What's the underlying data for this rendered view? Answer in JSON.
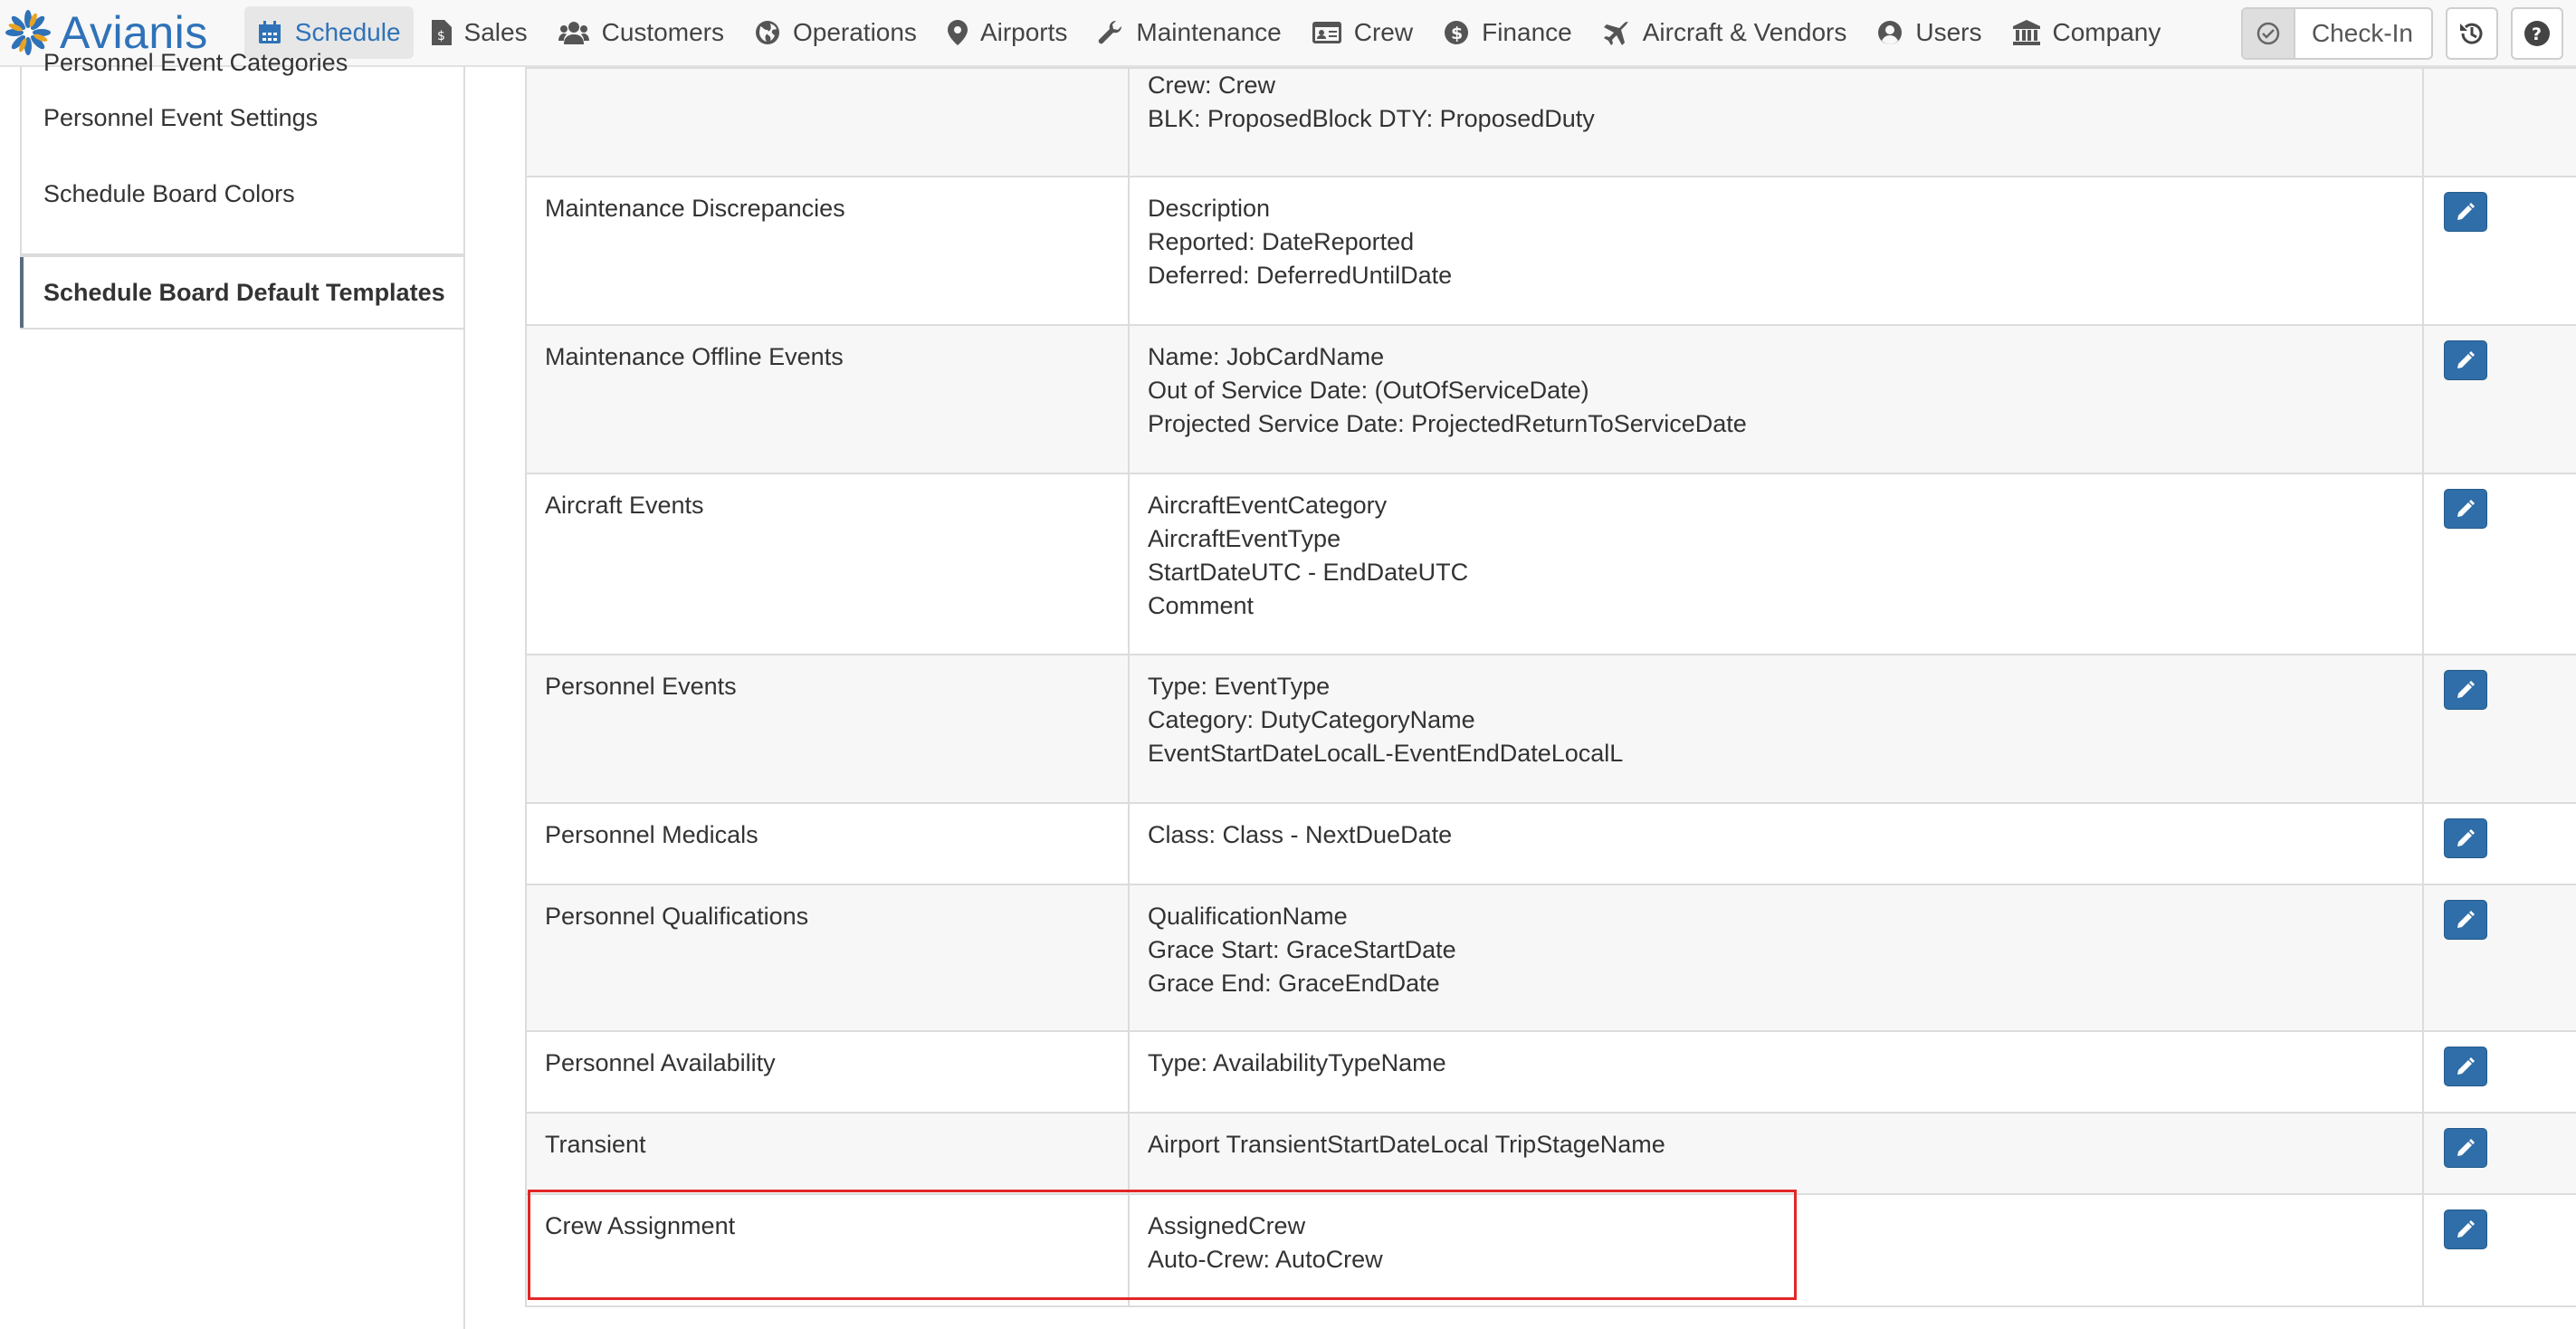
{
  "app": {
    "name": "Avianis"
  },
  "nav": {
    "items": [
      {
        "label": "Schedule",
        "icon": "calendar-icon",
        "active": true
      },
      {
        "label": "Sales",
        "icon": "invoice-icon"
      },
      {
        "label": "Customers",
        "icon": "users-group-icon"
      },
      {
        "label": "Operations",
        "icon": "globe-icon"
      },
      {
        "label": "Airports",
        "icon": "map-marker-icon"
      },
      {
        "label": "Maintenance",
        "icon": "wrench-icon"
      },
      {
        "label": "Crew",
        "icon": "id-card-icon"
      },
      {
        "label": "Finance",
        "icon": "dollar-icon"
      },
      {
        "label": "Aircraft & Vendors",
        "icon": "plane-icon"
      },
      {
        "label": "Users",
        "icon": "user-circle-icon"
      },
      {
        "label": "Company",
        "icon": "building-icon"
      }
    ],
    "checkin_label": "Check-In"
  },
  "sidebar": {
    "items": [
      {
        "label": "Personnel Event Categories"
      },
      {
        "label": "Personnel Event Settings"
      },
      {
        "label": "Schedule Board Colors"
      },
      {
        "label": "Schedule Board Default Templates",
        "active": true
      }
    ]
  },
  "table": {
    "rows": [
      {
        "name": "",
        "template": [
          "",
          "Crew: Crew",
          "BLK: ProposedBlock DTY: ProposedDuty"
        ]
      },
      {
        "name": "Maintenance Discrepancies",
        "template": [
          "Description",
          "Reported: DateReported",
          "Deferred: DeferredUntilDate"
        ]
      },
      {
        "name": "Maintenance Offline Events",
        "template": [
          "Name: JobCardName",
          "Out of Service Date: (OutOfServiceDate)",
          "Projected Service Date: ProjectedReturnToServiceDate"
        ]
      },
      {
        "name": "Aircraft Events",
        "template": [
          "AircraftEventCategory",
          "AircraftEventType",
          "StartDateUTC - EndDateUTC",
          "Comment"
        ]
      },
      {
        "name": "Personnel Events",
        "template": [
          "Type: EventType",
          "Category: DutyCategoryName",
          "EventStartDateLocalL-EventEndDateLocalL"
        ]
      },
      {
        "name": "Personnel Medicals",
        "template": [
          "Class: Class - NextDueDate"
        ]
      },
      {
        "name": "Personnel Qualifications",
        "template": [
          "QualificationName",
          "Grace Start: GraceStartDate",
          "Grace End: GraceEndDate"
        ]
      },
      {
        "name": "Personnel Availability",
        "template": [
          "Type: AvailabilityTypeName"
        ]
      },
      {
        "name": "Transient",
        "template": [
          "Airport TransientStartDateLocal TripStageName"
        ]
      },
      {
        "name": "Crew Assignment",
        "template": [
          "AssignedCrew",
          "Auto-Crew: AutoCrew"
        ]
      }
    ]
  },
  "colors": {
    "accent": "#2f72b8",
    "edit_button": "#2f6ea8",
    "highlight": "#e32626"
  }
}
